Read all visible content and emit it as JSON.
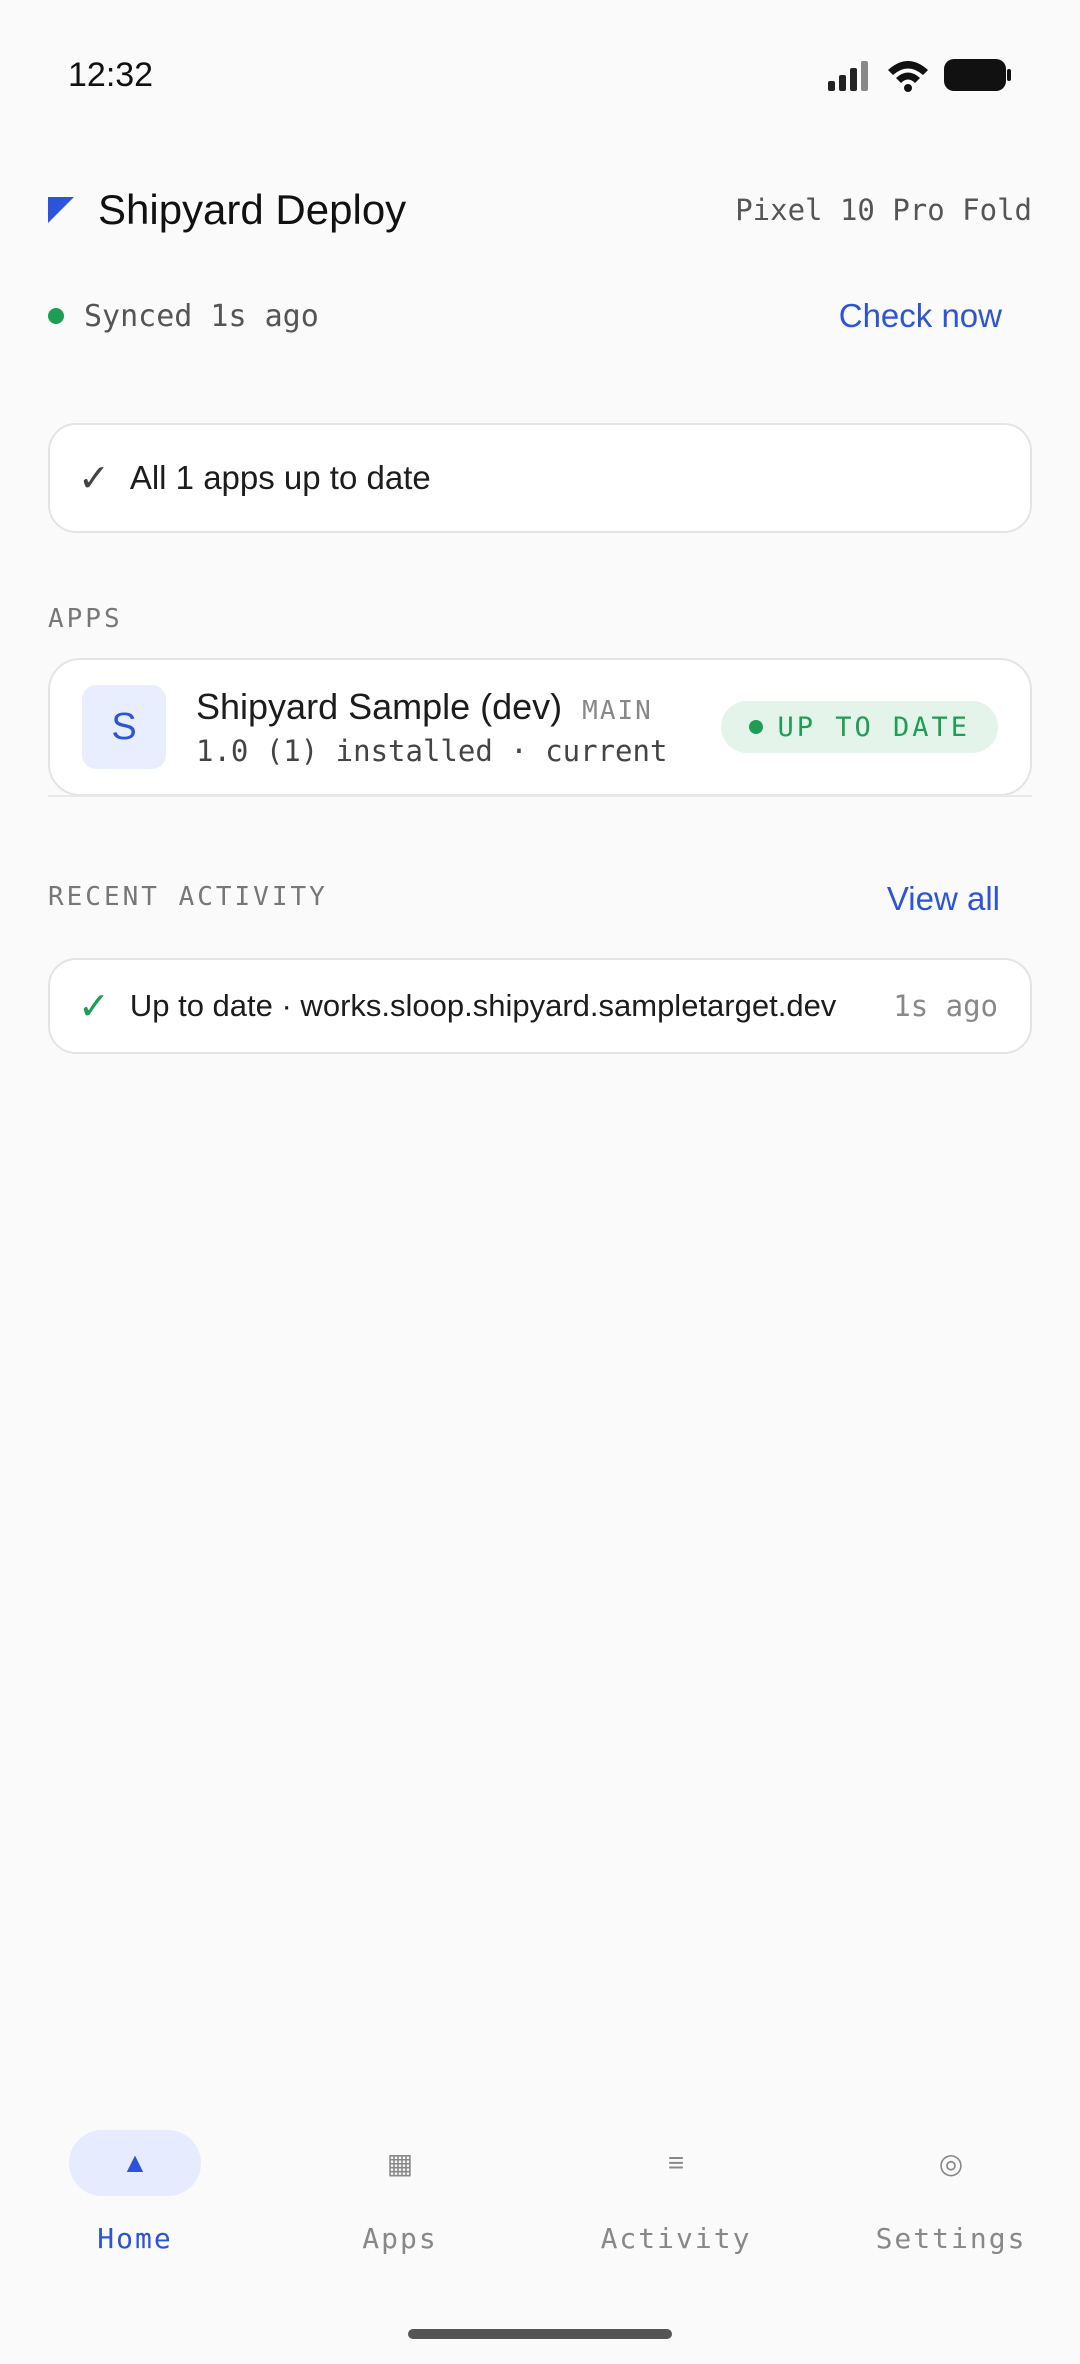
{
  "status_bar": {
    "time": "12:32"
  },
  "header": {
    "title": "Shipyard Deploy",
    "device": "Pixel 10 Pro Fold"
  },
  "sync": {
    "status": "Synced 1s ago",
    "action": "Check now"
  },
  "summary": {
    "text": "All 1 apps up to date"
  },
  "apps_section": {
    "label": "APPS",
    "items": [
      {
        "initial": "S",
        "name": "Shipyard Sample (dev)",
        "branch": "MAIN",
        "version": "1.0 (1) installed · current",
        "status": "UP TO DATE"
      }
    ]
  },
  "activity_section": {
    "label": "RECENT ACTIVITY",
    "view_all": "View all",
    "items": [
      {
        "text": "Up to date · works.sloop.shipyard.sampletarget.dev",
        "time": "1s ago"
      }
    ]
  },
  "nav": {
    "items": [
      {
        "label": "Home",
        "icon": "▲",
        "active": true
      },
      {
        "label": "Apps",
        "icon": "▦",
        "active": false
      },
      {
        "label": "Activity",
        "icon": "≡",
        "active": false
      },
      {
        "label": "Settings",
        "icon": "◎",
        "active": false
      }
    ]
  },
  "colors": {
    "accent": "#2b54d8",
    "success": "#1f9d55",
    "background": "#fafafa"
  }
}
